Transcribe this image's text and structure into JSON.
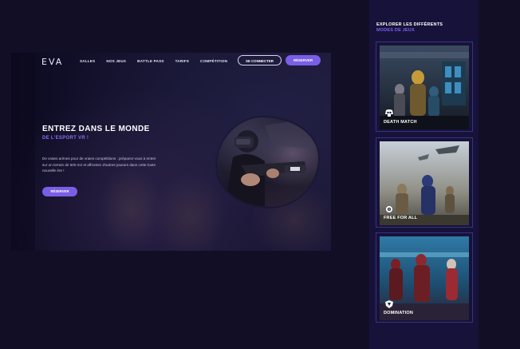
{
  "header": {
    "logo": "EVA",
    "nav": [
      "SALLES",
      "NOS JEUX",
      "BATTLE PASS",
      "TARIFS",
      "COMPÉTITION"
    ],
    "connect_label": "SE CONNECTER",
    "book_label": "RÉSERVER"
  },
  "hero": {
    "title_line1": "ENTREZ DANS LE MONDE",
    "title_line2": "DE L'ESPORT VR !",
    "description": "De vraies arènes pour de vraies compétitions : préparez-vous à entrer sur un terrain de 500 m2 et affrontez d'autres joueurs dans cette toute nouvelle ère !",
    "cta_label": "RÉSERVER"
  },
  "sidebar": {
    "title_line1": "EXPLORER LES DIFFÉRENTS",
    "title_line2": "MODES DE JEUX",
    "modes": [
      {
        "label": "DEATH MATCH",
        "icon": "skull-icon"
      },
      {
        "label": "FREE FOR ALL",
        "icon": "target-icon"
      },
      {
        "label": "DOMINATION",
        "icon": "shield-icon"
      }
    ]
  },
  "colors": {
    "accent": "#7b5ee6",
    "background": "#110e26",
    "sidebar": "#17123a"
  }
}
